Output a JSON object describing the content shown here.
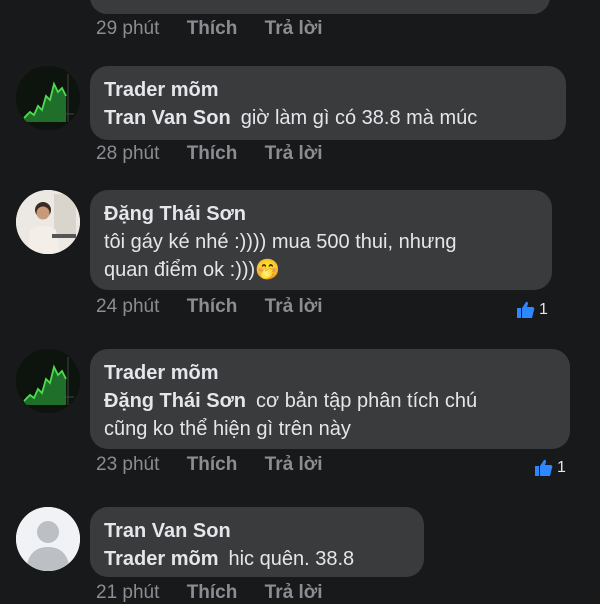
{
  "comments": [
    {
      "time": "29 phút",
      "like": "Thích",
      "reply": "Trả lời"
    },
    {
      "author": "Trader mõm",
      "mention": "Tran Van Son",
      "text": "giờ làm gì có 38.8 mà múc",
      "time": "28 phút",
      "like": "Thích",
      "reply": "Trả lời",
      "avatar_icon": "chart-avatar"
    },
    {
      "author": "Đặng Thái Sơn",
      "text_line1": "tôi gáy ké nhé :)))) mua 500 thui, nhưng",
      "text_line2": "quan điểm ok :)))",
      "emoji": "🤭",
      "time": "24 phút",
      "like": "Thích",
      "reply": "Trả lời",
      "reactions": "1",
      "avatar_icon": "person-avatar"
    },
    {
      "author": "Trader mõm",
      "mention": "Đặng Thái Sơn",
      "text_line1": "cơ bản tập phân tích chú",
      "text_line2": "cũng ko thể hiện gì trên này",
      "time": "23 phút",
      "like": "Thích",
      "reply": "Trả lời",
      "reactions": "1",
      "avatar_icon": "chart-avatar"
    },
    {
      "author": "Tran Van Son",
      "mention": "Trader mõm",
      "text": "hic quên. 38.8",
      "time": "21 phút",
      "like": "Thích",
      "reply": "Trả lời",
      "avatar_icon": "default-avatar"
    }
  ],
  "colors": {
    "background": "#18191a",
    "bubble": "#3a3b3c",
    "meta": "#8a8d91",
    "like_blue": "#2d88ff"
  }
}
